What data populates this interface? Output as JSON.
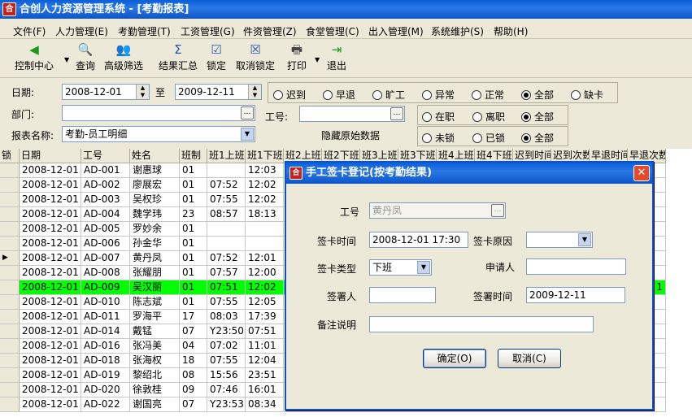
{
  "window": {
    "title": "合创人力资源管理系统 - [考勤报表]",
    "icon_text": "合"
  },
  "menu": [
    "文件(F)",
    "人力管理(E)",
    "考勤管理(T)",
    "工资管理(G)",
    "件资管理(Z)",
    "食堂管理(C)",
    "出入管理(M)",
    "系统维护(S)",
    "帮助(H)"
  ],
  "toolbar": [
    {
      "label": "控制中心",
      "icon": "arrow-left-icon"
    },
    {
      "label": "查询",
      "icon": "search-icon"
    },
    {
      "label": "高级筛选",
      "icon": "users-icon"
    },
    {
      "label": "结果汇总",
      "icon": "sigma-icon"
    },
    {
      "label": "锁定",
      "icon": "check-icon"
    },
    {
      "label": "取消锁定",
      "icon": "cancel-icon"
    },
    {
      "label": "打印",
      "icon": "printer-icon"
    },
    {
      "label": "退出",
      "icon": "exit-icon"
    }
  ],
  "filter": {
    "date_label": "日期:",
    "date_from": "2008-12-01",
    "to_label": "至",
    "date_to": "2009-12-11",
    "dept_label": "部门:",
    "dept_value": "",
    "empno_label": "工号:",
    "empno_value": "",
    "report_label": "报表名称:",
    "report_value": "考勤-员工明细",
    "hide_label": "隐藏原始数据",
    "status_options": [
      "迟到",
      "早退",
      "旷工",
      "异常",
      "正常",
      "全部",
      "缺卡"
    ],
    "status_selected": "全部",
    "employ_options": [
      "在职",
      "离职",
      "全部"
    ],
    "employ_selected": "全部",
    "lock_options": [
      "未锁",
      "已锁",
      "全部"
    ],
    "lock_selected": "全部"
  },
  "grid": {
    "columns": [
      "锁",
      "日期",
      "工号",
      "姓名",
      "班制",
      "班1上班",
      "班1下班",
      "班2上班",
      "班2下班",
      "班3上班",
      "班3下班",
      "班4上班",
      "班4下班",
      "迟到时间",
      "迟到次数",
      "早退时间",
      "早退次数"
    ],
    "rows": [
      [
        "2008-12-01",
        "AD-001",
        "谢惠球",
        "01",
        "",
        "12:03"
      ],
      [
        "2008-12-01",
        "AD-002",
        "廖展宏",
        "01",
        "07:52",
        "12:02"
      ],
      [
        "2008-12-01",
        "AD-003",
        "吴权珍",
        "01",
        "07:55",
        "12:02"
      ],
      [
        "2008-12-01",
        "AD-004",
        "魏学玮",
        "23",
        "08:57",
        "18:13"
      ],
      [
        "2008-12-01",
        "AD-005",
        "罗妙余",
        "01",
        "",
        ""
      ],
      [
        "2008-12-01",
        "AD-006",
        "孙金华",
        "01",
        "",
        ""
      ],
      [
        "2008-12-01",
        "AD-007",
        "黄丹凤",
        "01",
        "07:52",
        "12:01"
      ],
      [
        "2008-12-01",
        "AD-008",
        "张耀朋",
        "01",
        "07:57",
        "12:00"
      ],
      [
        "2008-12-01",
        "AD-009",
        "吴汉丽",
        "01",
        "07:51",
        "12:02"
      ],
      [
        "2008-12-01",
        "AD-010",
        "陈志斌",
        "01",
        "07:55",
        "12:05"
      ],
      [
        "2008-12-01",
        "AD-011",
        "罗海平",
        "17",
        "08:03",
        "17:39"
      ],
      [
        "2008-12-01",
        "AD-014",
        "戴锰",
        "07",
        "Y23:50",
        "07:51"
      ],
      [
        "2008-12-01",
        "AD-016",
        "张冯美",
        "04",
        "07:02",
        "11:01"
      ],
      [
        "2008-12-01",
        "AD-018",
        "张海权",
        "18",
        "07:55",
        "12:04"
      ],
      [
        "2008-12-01",
        "AD-019",
        "黎绍北",
        "08",
        "15:56",
        "23:51"
      ],
      [
        "2008-12-01",
        "AD-020",
        "徐敦桂",
        "09",
        "07:46",
        "16:01"
      ],
      [
        "2008-12-01",
        "AD-022",
        "谢国亮",
        "07",
        "Y23:53",
        "08:34"
      ]
    ],
    "current_row": 6,
    "highlight_row": 8,
    "highlight_extra": "1",
    "highlight_color": "#00ff00"
  },
  "dialog": {
    "title": "手工签卡登记(按考勤结果)",
    "emp_label": "工号",
    "emp_value": "黄丹凤",
    "time_label": "签卡时间",
    "time_value": "2008-12-01 17:30",
    "reason_label": "签卡原因",
    "reason_value": "",
    "type_label": "签卡类型",
    "type_value": "下班",
    "applicant_label": "申请人",
    "applicant_value": "",
    "signer_label": "签署人",
    "signer_value": "",
    "sign_time_label": "签署时间",
    "sign_time_value": "2009-12-11",
    "note_label": "备注说明",
    "note_value": "",
    "ok_label": "确定(O)",
    "cancel_label": "取消(C)"
  }
}
